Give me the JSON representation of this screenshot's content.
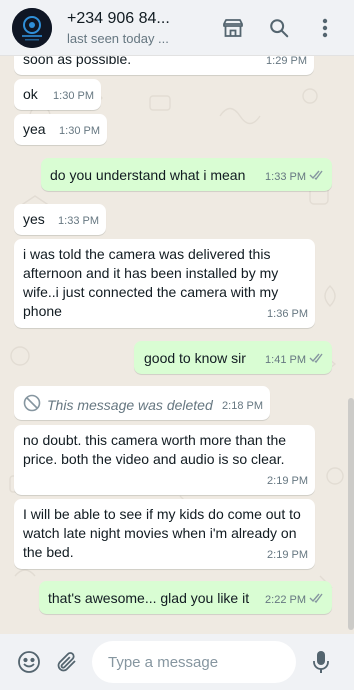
{
  "header": {
    "contact_name": "+234 906 84...",
    "contact_status": "last seen today ...",
    "icons": [
      "store-icon",
      "search-icon",
      "more-vertical-icon"
    ]
  },
  "messages": [
    {
      "dir": "in",
      "text": "soon as possible.",
      "time": "1:29 PM"
    },
    {
      "dir": "in",
      "text": "ok",
      "time": "1:30 PM"
    },
    {
      "dir": "in",
      "text": "yea",
      "time": "1:30 PM"
    },
    {
      "dir": "out",
      "text": "do you understand what i mean",
      "time": "1:33 PM",
      "read": true
    },
    {
      "dir": "in",
      "text": "yes",
      "time": "1:33 PM"
    },
    {
      "dir": "in",
      "text": "i was told the camera was delivered this afternoon and it has been installed by my wife..i just connected the camera with my phone",
      "time": "1:36 PM"
    },
    {
      "dir": "out",
      "text": "good to know sir",
      "time": "1:41 PM",
      "read": true
    },
    {
      "dir": "in",
      "text": "This message was deleted",
      "time": "2:18 PM",
      "deleted": true
    },
    {
      "dir": "in",
      "text": "no doubt. this camera worth more than the price. both the video and audio is so clear.",
      "time": "2:19 PM"
    },
    {
      "dir": "in",
      "text": "I will be able to see if my kids do come out to watch late  night movies when i'm already on the bed.",
      "time": "2:19 PM"
    },
    {
      "dir": "out",
      "text": "that's awesome... glad you like it",
      "time": "2:22 PM",
      "read": true
    }
  ],
  "composer": {
    "placeholder": "Type a message",
    "value": ""
  },
  "colors": {
    "header_bg": "#f0f2f5",
    "chat_bg": "#efeae2",
    "incoming_bubble": "#ffffff",
    "outgoing_bubble": "#d9fdd3",
    "tick_color": "#8696a0"
  }
}
